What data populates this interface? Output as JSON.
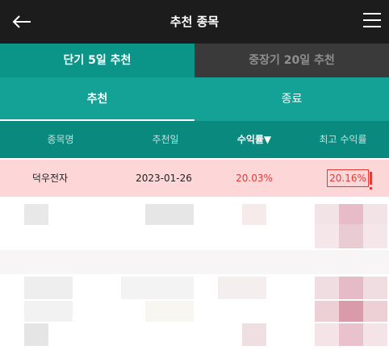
{
  "header": {
    "title": "추천 종목",
    "back_icon": "arrow-left-icon",
    "menu_icon": "hamburger-menu-icon"
  },
  "segments": {
    "active": "단기 5일 추천",
    "inactive": "중장기 20일 추천"
  },
  "tabs": {
    "left": "추천",
    "right": "종료"
  },
  "table": {
    "columns": [
      "종목명",
      "추천일",
      "수익률▼",
      "최고 수익률"
    ],
    "rows": [
      {
        "name": "덕우전자",
        "date": "2023-01-26",
        "return": "20.03%",
        "max_return": "20.16%"
      }
    ]
  },
  "colors": {
    "accent": "#0a9588",
    "dark": "#1c1c1c",
    "highlight_row": "#fdd6d8",
    "red": "#e53935"
  }
}
